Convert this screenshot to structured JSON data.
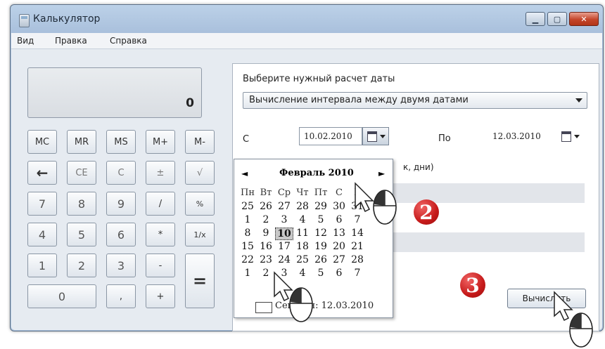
{
  "window": {
    "title": "Калькулятор"
  },
  "menu": {
    "items": [
      "Вид",
      "Правка",
      "Справка"
    ]
  },
  "display": {
    "value": "0"
  },
  "keys": {
    "mc": "MC",
    "mr": "MR",
    "ms": "MS",
    "mplus": "M+",
    "mminus": "M-",
    "back": "←",
    "ce": "CE",
    "c": "C",
    "plusminus": "±",
    "sqrt": "√",
    "n7": "7",
    "n8": "8",
    "n9": "9",
    "div": "/",
    "pct": "%",
    "n4": "4",
    "n5": "5",
    "n6": "6",
    "mul": "*",
    "inv": "1/x",
    "n1": "1",
    "n2": "2",
    "n3": "3",
    "minus": "-",
    "eq": "=",
    "n0": "0",
    "dot": ",",
    "plus": "+"
  },
  "date_calc": {
    "prompt": "Выберите нужный расчет даты",
    "mode": "Вычисление интервала между двумя датами",
    "from_label": "С",
    "from_date": "10.02.2010",
    "to_label": "По",
    "to_date": "12.03.2010",
    "result_fragment": "к, дни)",
    "calculate_button": "Вычислить"
  },
  "calendar": {
    "month": "Февраль 2010",
    "prev": "◄",
    "next": "►",
    "weekdays": [
      "Пн",
      "Вт",
      "Ср",
      "Чт",
      "Пт",
      "С",
      "В"
    ],
    "rows": [
      [
        "25",
        "26",
        "27",
        "28",
        "29",
        "30",
        "31"
      ],
      [
        "1",
        "2",
        "3",
        "4",
        "5",
        "6",
        "7"
      ],
      [
        "8",
        "9",
        "10",
        "11",
        "12",
        "13",
        "14"
      ],
      [
        "15",
        "16",
        "17",
        "18",
        "19",
        "20",
        "21"
      ],
      [
        "22",
        "23",
        "24",
        "25",
        "26",
        "27",
        "28"
      ],
      [
        "1",
        "2",
        "3",
        "4",
        "5",
        "6",
        "7"
      ]
    ],
    "selected": "10",
    "today_label": "Сегодня: 12.03.2010"
  },
  "annotations": {
    "step2": "2",
    "step3": "3"
  }
}
